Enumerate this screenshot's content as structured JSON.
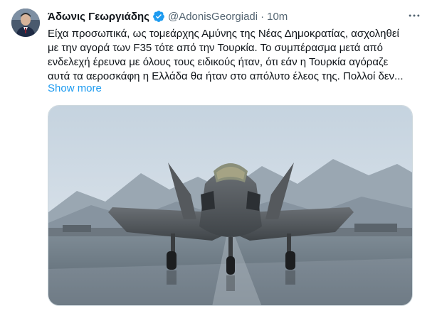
{
  "tweet": {
    "author_name": "Άδωνις Γεωργιάδης",
    "handle": "@AdonisGeorgiadi",
    "separator": "·",
    "time": "10m",
    "lines": [
      "Είχα προσωπικά, ως τομεάρχης Αμύνης της Νέας Δημοκρατίας, ασχοληθεί",
      "με την αγορά των F35 τότε από την Τουρκία. Το συμπέρασμα μετά από",
      "ενδελεχή έρευνα με όλους τους ειδικούς ήταν, ότι εάν η Τουρκία αγόραζε",
      "αυτά τα αεροσκάφη η Ελλάδα θα ήταν στο απόλυτο έλεος της. Πολλοί δεν..."
    ],
    "show_more": "Show more",
    "verified_icon": "verified-badge-icon",
    "more_icon": "more-options-icon",
    "accent_color": "#1d9bf0"
  },
  "media": {
    "description_icon": "f35-jet-photo"
  }
}
